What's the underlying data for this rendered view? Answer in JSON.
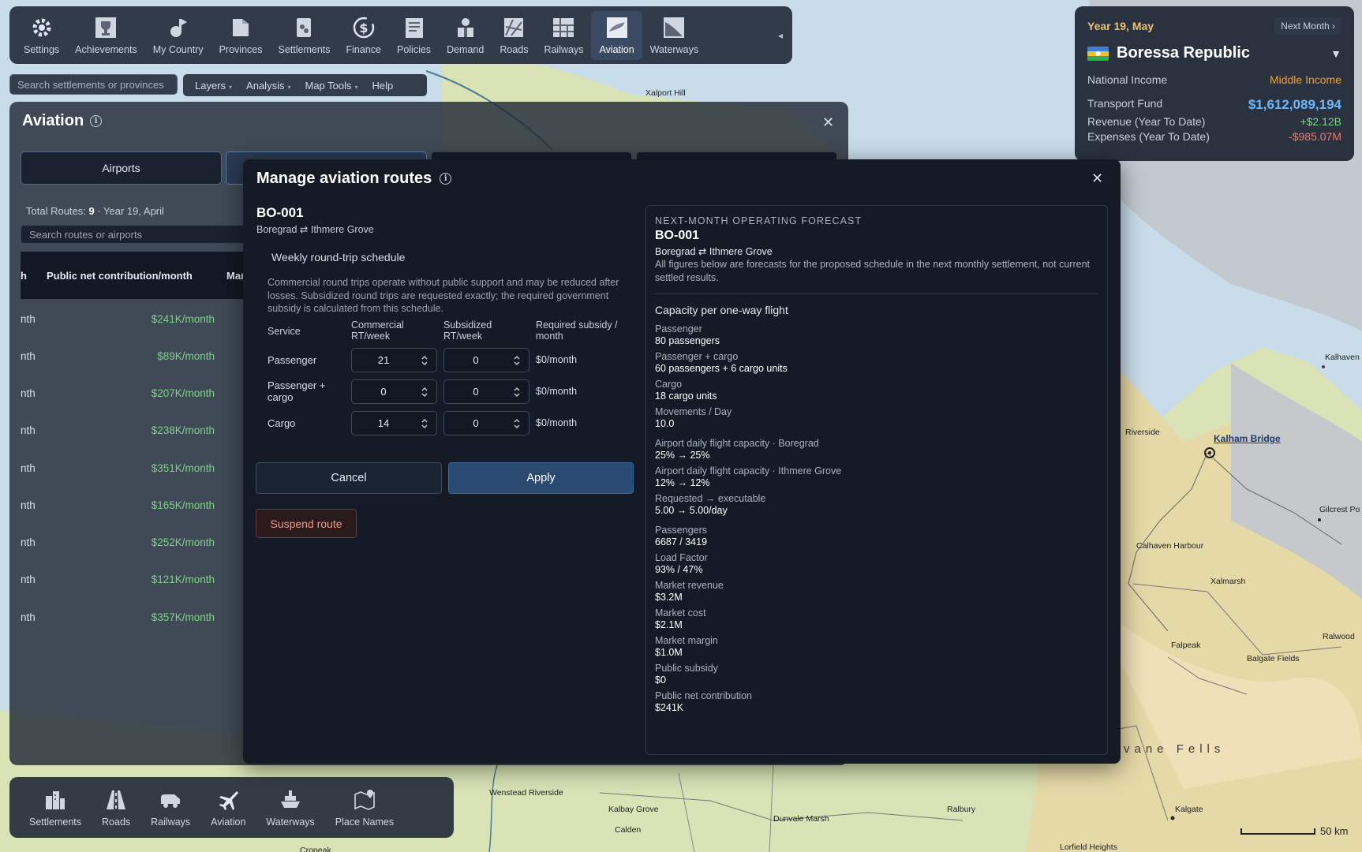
{
  "toolbar": {
    "items": [
      {
        "label": "Settings",
        "icon": "gear-icon"
      },
      {
        "label": "Achievements",
        "icon": "trophy-icon"
      },
      {
        "label": "My Country",
        "icon": "country-icon"
      },
      {
        "label": "Provinces",
        "icon": "provinces-icon"
      },
      {
        "label": "Settlements",
        "icon": "settlements-icon"
      },
      {
        "label": "Finance",
        "icon": "dollar-icon"
      },
      {
        "label": "Policies",
        "icon": "policies-icon"
      },
      {
        "label": "Demand",
        "icon": "demand-icon"
      },
      {
        "label": "Roads",
        "icon": "roads-icon"
      },
      {
        "label": "Railways",
        "icon": "railways-icon"
      },
      {
        "label": "Aviation",
        "icon": "aviation-icon",
        "active": true
      },
      {
        "label": "Waterways",
        "icon": "waterways-icon"
      }
    ],
    "collapse": "◂"
  },
  "search": {
    "placeholder": "Search settlements or provinces"
  },
  "menu": {
    "layers": "Layers",
    "analysis": "Analysis",
    "map_tools": "Map Tools",
    "help": "Help",
    "caret": "▾"
  },
  "nation": {
    "date": "Year 19, May",
    "next_month": "Next Month ›",
    "country": "Boressa Republic",
    "dropdown": "▼",
    "national_income_label": "National Income",
    "national_income_value": "Middle Income",
    "transport_fund_label": "Transport Fund",
    "transport_fund_value": "$1,612,089,194",
    "revenue_label": "Revenue (Year To Date)",
    "revenue_value": "+$2.12B",
    "expenses_label": "Expenses (Year To Date)",
    "expenses_value": "-$985.07M"
  },
  "aviation": {
    "title": "Aviation",
    "info": "i",
    "close": "✕",
    "tabs": [
      {
        "label": "Airports"
      },
      {
        "label": ""
      },
      {
        "label": ""
      },
      {
        "label": ""
      }
    ],
    "total_prefix": "Total Routes: ",
    "total_count": "9",
    "total_suffix": " · Year 19, April",
    "route_search_placeholder": "Search routes or airports",
    "headers": {
      "col0": "h",
      "col1": "Public net contribution/month",
      "col2": "Marke"
    },
    "rows": [
      {
        "c1": "nth",
        "c2": "$241K/month"
      },
      {
        "c1": "nth",
        "c2": "$89K/month"
      },
      {
        "c1": "nth",
        "c2": "$207K/month"
      },
      {
        "c1": "nth",
        "c2": "$238K/month"
      },
      {
        "c1": "nth",
        "c2": "$351K/month"
      },
      {
        "c1": "nth",
        "c2": "$165K/month"
      },
      {
        "c1": "nth",
        "c2": "$252K/month"
      },
      {
        "c1": "nth",
        "c2": "$121K/month"
      },
      {
        "c1": "nth",
        "c2": "$357K/month"
      }
    ]
  },
  "modal": {
    "title": "Manage aviation routes",
    "info": "i",
    "close": "✕",
    "route_id": "BO-001",
    "route_pair": "Boregrad ⇄ Ithmere Grove",
    "schedule_title": "Weekly round-trip schedule",
    "schedule_desc": "Commercial round trips operate without public support and may be reduced after losses. Subsidized round trips are requested exactly; the required government subsidy is calculated from this schedule.",
    "headers": {
      "service": "Service",
      "commercial": "Commercial RT/week",
      "subsidized": "Subsidized RT/week",
      "required": "Required subsidy / month"
    },
    "services": [
      {
        "label": "Passenger",
        "commercial": "21",
        "subsidized": "0",
        "subsidy": "$0/month"
      },
      {
        "label": "Passenger + cargo",
        "commercial": "0",
        "subsidized": "0",
        "subsidy": "$0/month"
      },
      {
        "label": "Cargo",
        "commercial": "14",
        "subsidized": "0",
        "subsidy": "$0/month"
      }
    ],
    "cancel": "Cancel",
    "apply": "Apply",
    "suspend": "Suspend route"
  },
  "forecast": {
    "kicker": "NEXT-MONTH OPERATING FORECAST",
    "route_id": "BO-001",
    "route_pair": "Boregrad ⇄ Ithmere Grove",
    "note": "All figures below are forecasts for the proposed schedule in the next monthly settlement, not current settled results.",
    "section": "Capacity per one-way flight",
    "metrics": [
      {
        "k": "Passenger",
        "v": "80 passengers"
      },
      {
        "k": "Passenger + cargo",
        "v": "60 passengers + 6 cargo units"
      },
      {
        "k": "Cargo",
        "v": "18 cargo units"
      },
      {
        "k": "Movements / Day",
        "v": "10.0"
      },
      {
        "k": "Airport daily flight capacity · Boregrad",
        "v": "25% → 25%"
      },
      {
        "k": "Airport daily flight capacity · Ithmere Grove",
        "v": "12% → 12%"
      },
      {
        "k": "Requested → executable",
        "v": "5.00 → 5.00/day"
      },
      {
        "k": "Passengers",
        "v": "6687 / 3419"
      },
      {
        "k": "Load Factor",
        "v": "93% / 47%"
      },
      {
        "k": "Market revenue",
        "v": "$3.2M"
      },
      {
        "k": "Market cost",
        "v": "$2.1M"
      },
      {
        "k": "Market margin",
        "v": "$1.0M"
      },
      {
        "k": "Public subsidy",
        "v": "$0"
      },
      {
        "k": "Public net contribution",
        "v": "$241K"
      }
    ]
  },
  "bottombar": {
    "items": [
      {
        "label": "Settlements",
        "icon": "buildings-icon"
      },
      {
        "label": "Roads",
        "icon": "road-icon"
      },
      {
        "label": "Railways",
        "icon": "train-icon"
      },
      {
        "label": "Aviation",
        "icon": "plane-icon"
      },
      {
        "label": "Waterways",
        "icon": "ship-icon"
      },
      {
        "label": "Place Names",
        "icon": "map-pin-icon"
      }
    ]
  },
  "map": {
    "labels": [
      "Xalport Hill",
      "Kalhaven",
      "Riverside",
      "Kalham Bridge",
      "Gilcrest Po",
      "Calhaven Harbour",
      "Xalmarsh",
      "Ralwood",
      "Falpeak",
      "Balgate Fields",
      "vane Fells",
      "Wenstead Riverside",
      "Kalbay Grove",
      "Calden",
      "Dunvale Marsh",
      "Ralbury",
      "Kalgate",
      "Lorfield Heights",
      "Cropeak"
    ],
    "scale": "50 km"
  },
  "colors": {
    "accent": "#2a4a72",
    "positive": "#7fd08a",
    "negative": "#f07a6a",
    "gold": "#f0a030",
    "fund": "#6ab8ff"
  }
}
